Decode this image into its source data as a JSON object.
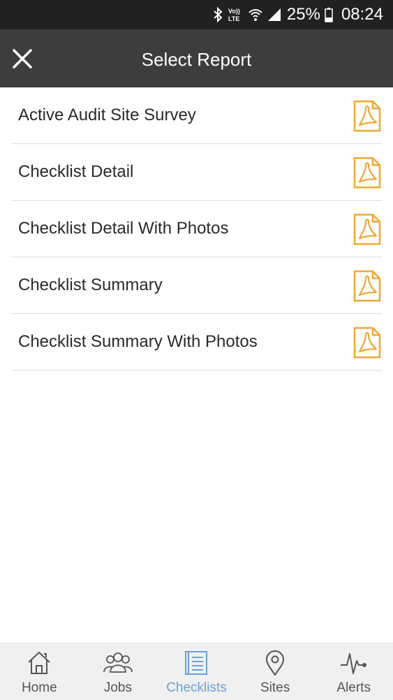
{
  "status_bar": {
    "icons": [
      "bluetooth-icon",
      "volte-icon",
      "wifi-icon",
      "signal-icon",
      "battery-icon"
    ],
    "volte_text": "Vo)) LTE",
    "battery": "25%",
    "time": "08:24"
  },
  "header": {
    "title": "Select Report",
    "close_icon": "close-icon"
  },
  "reports": [
    {
      "label": "Active Audit Site Survey",
      "icon": "pdf-icon"
    },
    {
      "label": "Checklist Detail",
      "icon": "pdf-icon"
    },
    {
      "label": "Checklist Detail With Photos",
      "icon": "pdf-icon"
    },
    {
      "label": "Checklist Summary",
      "icon": "pdf-icon"
    },
    {
      "label": "Checklist Summary With Photos",
      "icon": "pdf-icon"
    }
  ],
  "bottom_nav": {
    "items": [
      {
        "label": "Home",
        "icon": "home-icon",
        "active": false
      },
      {
        "label": "Jobs",
        "icon": "people-icon",
        "active": false
      },
      {
        "label": "Checklists",
        "icon": "checklist-icon",
        "active": true
      },
      {
        "label": "Sites",
        "icon": "map-pin-icon",
        "active": false
      },
      {
        "label": "Alerts",
        "icon": "pulse-icon",
        "active": false
      }
    ]
  },
  "colors": {
    "status_bar_bg": "#212121",
    "header_bg": "#3d3d3d",
    "pdf_icon": "#f0a830",
    "nav_active": "#6aa0d8",
    "nav_bg": "#f0f0f0"
  }
}
